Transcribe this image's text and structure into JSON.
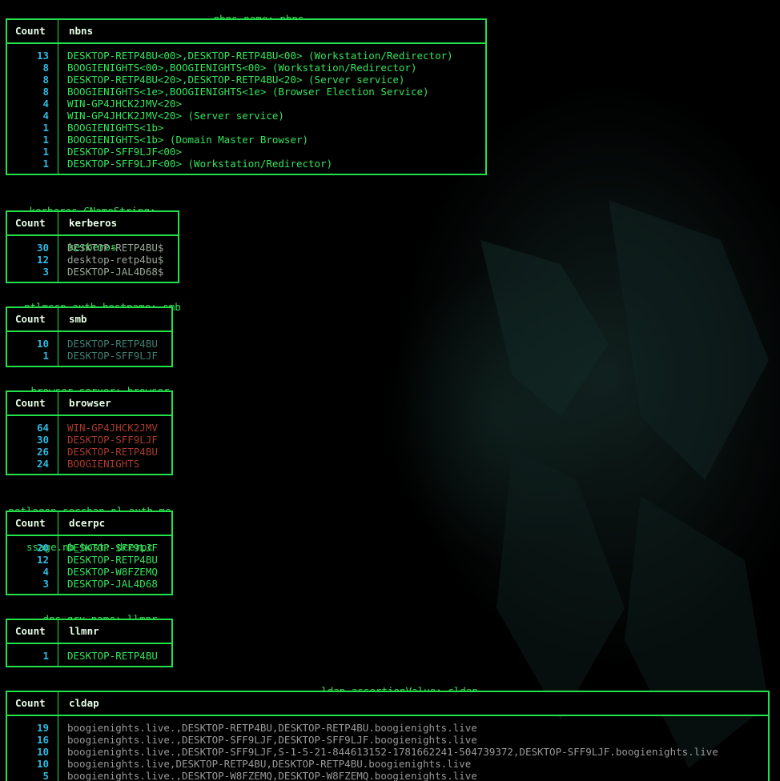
{
  "colors": {
    "border": "#22e24a",
    "caption": "#35e35a",
    "count": "#31b7e0",
    "header": "#e8ffe8",
    "value_default": "#35e35a",
    "value_smb": "#3f7f6f",
    "value_browser": "#a83a2c",
    "value_cldap": "#9a9a9a",
    "value_kerberos": "#9aa89a"
  },
  "sections": [
    {
      "id": "nbns",
      "caption": [
        "nbns.name: nbns"
      ],
      "count_header": "Count",
      "field_header": "nbns",
      "rows": [
        {
          "count": "13",
          "value": "DESKTOP-RETP4BU<00>,DESKTOP-RETP4BU<00> (Workstation/Redirector)"
        },
        {
          "count": "8",
          "value": "BOOGIENIGHTS<00>,BOOGIENIGHTS<00> (Workstation/Redirector)"
        },
        {
          "count": "8",
          "value": "DESKTOP-RETP4BU<20>,DESKTOP-RETP4BU<20> (Server service)"
        },
        {
          "count": "8",
          "value": "BOOGIENIGHTS<1e>,BOOGIENIGHTS<1e> (Browser Election Service)"
        },
        {
          "count": "4",
          "value": "WIN-GP4JHCK2JMV<20>"
        },
        {
          "count": "4",
          "value": "WIN-GP4JHCK2JMV<20> (Server service)"
        },
        {
          "count": "1",
          "value": "BOOGIENIGHTS<1b>"
        },
        {
          "count": "1",
          "value": "BOOGIENIGHTS<1b> (Domain Master Browser)"
        },
        {
          "count": "1",
          "value": "DESKTOP-SFF9LJF<00>"
        },
        {
          "count": "1",
          "value": "DESKTOP-SFF9LJF<00> (Workstation/Redirector)"
        }
      ]
    },
    {
      "id": "kerberos",
      "caption": [
        "kerberos.CNameString:",
        "kerberos"
      ],
      "count_header": "Count",
      "field_header": "kerberos",
      "rows": [
        {
          "count": "30",
          "value": "DESKTOP-RETP4BU$"
        },
        {
          "count": "12",
          "value": "desktop-retp4bu$"
        },
        {
          "count": "3",
          "value": "DESKTOP-JAL4D68$"
        }
      ]
    },
    {
      "id": "smb",
      "caption": [
        "ntlmssp.auth.hostname: smb"
      ],
      "count_header": "Count",
      "field_header": "smb",
      "rows": [
        {
          "count": "10",
          "value": "DESKTOP-RETP4BU"
        },
        {
          "count": "1",
          "value": "DESKTOP-SFF9LJF"
        }
      ]
    },
    {
      "id": "browser",
      "caption": [
        "browser.server: browser"
      ],
      "count_header": "Count",
      "field_header": "browser",
      "rows": [
        {
          "count": "64",
          "value": "WIN-GP4JHCK2JMV"
        },
        {
          "count": "30",
          "value": "DESKTOP-SFF9LJF"
        },
        {
          "count": "26",
          "value": "DESKTOP-RETP4BU"
        },
        {
          "count": "24",
          "value": "BOOGIENIGHTS"
        }
      ]
    },
    {
      "id": "dcerpc",
      "caption": [
        "netlogon.secchan.nl_auth_me",
        "ssage.nb_host: dcerpc"
      ],
      "count_header": "Count",
      "field_header": "dcerpc",
      "rows": [
        {
          "count": "20",
          "value": "DESKTOP-SFF9LJF"
        },
        {
          "count": "12",
          "value": "DESKTOP-RETP4BU"
        },
        {
          "count": "4",
          "value": "DESKTOP-W8FZEMQ"
        },
        {
          "count": "3",
          "value": "DESKTOP-JAL4D68"
        }
      ]
    },
    {
      "id": "llmnr",
      "caption": [
        "dns.qry.name: llmnr"
      ],
      "count_header": "Count",
      "field_header": "llmnr",
      "rows": [
        {
          "count": "1",
          "value": "DESKTOP-RETP4BU"
        }
      ]
    },
    {
      "id": "cldap",
      "caption": [
        "ldap.assertionValue: cldap"
      ],
      "count_header": "Count",
      "field_header": "cldap",
      "rows": [
        {
          "count": "19",
          "value": "boogienights.live.,DESKTOP-RETP4BU,DESKTOP-RETP4BU.boogienights.live"
        },
        {
          "count": "16",
          "value": "boogienights.live.,DESKTOP-SFF9LJF,DESKTOP-SFF9LJF.boogienights.live"
        },
        {
          "count": "10",
          "value": "boogienights.live.,DESKTOP-SFF9LJF,S-1-5-21-844613152-1781662241-504739372,DESKTOP-SFF9LJF.boogienights.live"
        },
        {
          "count": "10",
          "value": "boogienights.live,DESKTOP-RETP4BU,DESKTOP-RETP4BU.boogienights.live"
        },
        {
          "count": "5",
          "value": "boogienights.live.,DESKTOP-W8FZEMQ,DESKTOP-W8FZEMQ.boogienights.live"
        }
      ]
    }
  ]
}
